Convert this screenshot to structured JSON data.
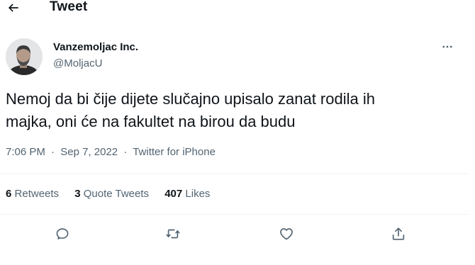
{
  "header": {
    "title": "Tweet",
    "back_icon": "arrow-left-icon"
  },
  "author": {
    "name": "Vanzemoljac Inc.",
    "handle": "@MoljacU",
    "more_icon": "more-horizontal-icon"
  },
  "tweet": {
    "text_line1": "Nemoj da bi čije dijete slučajno upisalo zanat rodila ih",
    "text_line2": "majka, oni će na fakultet na birou da budu",
    "time": "7:06 PM",
    "date": "Sep 7, 2022",
    "separator": "·",
    "source": "Twitter for iPhone"
  },
  "stats": {
    "retweets_count": "6",
    "retweets_label": "Retweets",
    "quote_count": "3",
    "quote_label": "Quote Tweets",
    "likes_count": "407",
    "likes_label": "Likes"
  },
  "actions": {
    "reply_icon": "reply-icon",
    "retweet_icon": "retweet-icon",
    "like_icon": "heart-icon",
    "share_icon": "share-icon"
  },
  "colors": {
    "text_primary": "#0f1419",
    "text_secondary": "#536471",
    "divider": "#eff3f4",
    "background": "#ffffff"
  }
}
